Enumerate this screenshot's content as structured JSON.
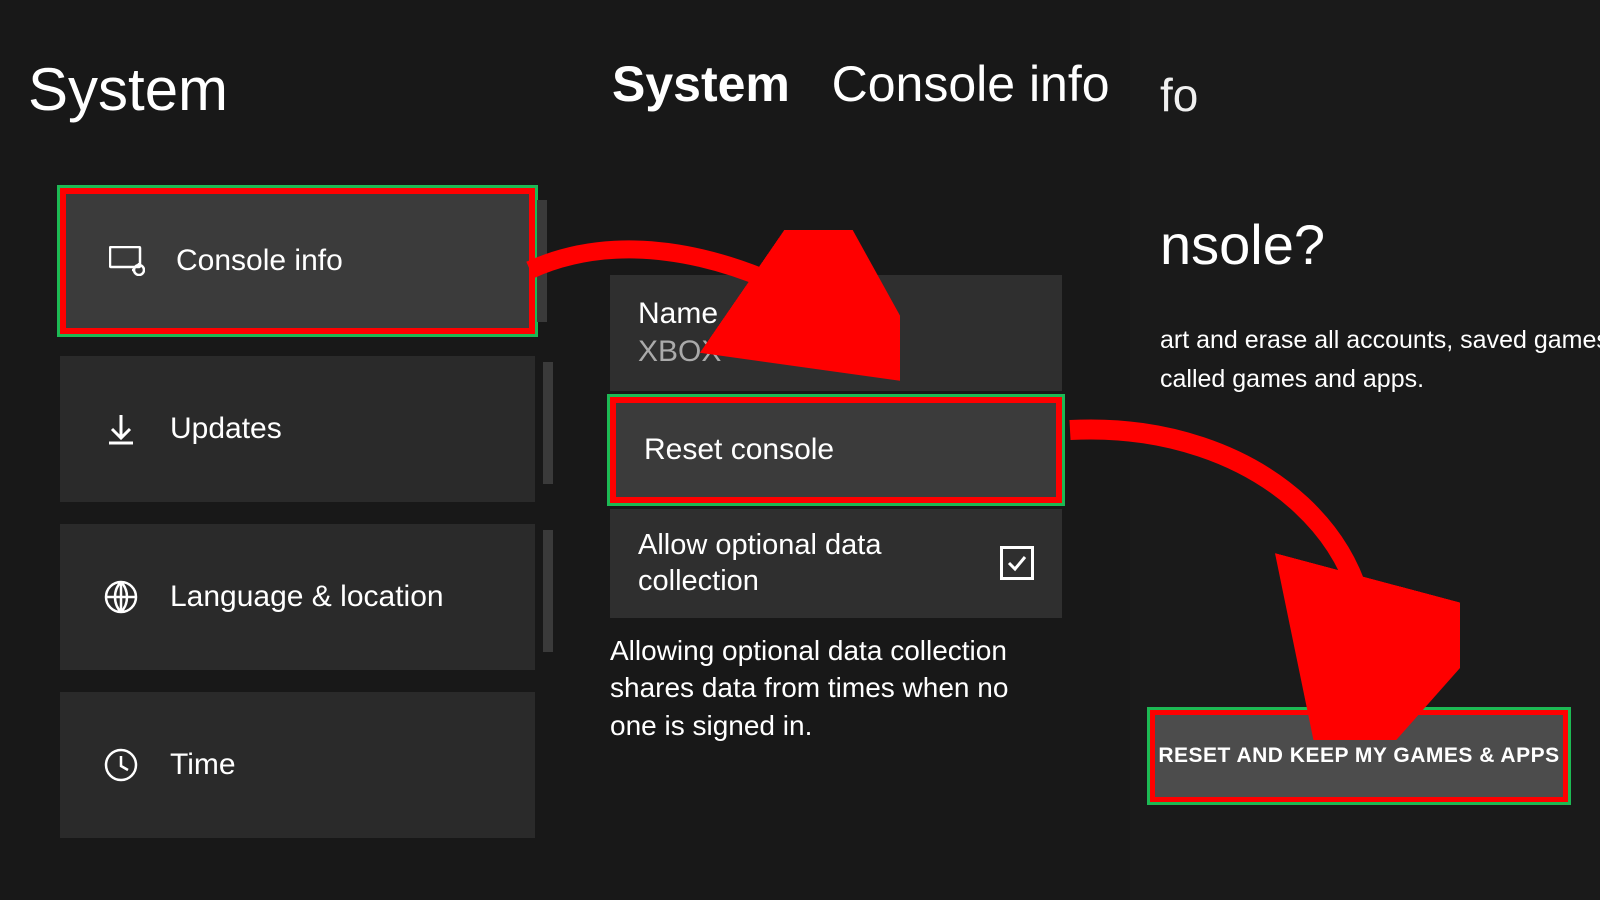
{
  "left": {
    "title": "System"
  },
  "mid": {
    "title_bold": "System",
    "title_rest": "Console info"
  },
  "sidebar": {
    "items": [
      {
        "label": "Console info"
      },
      {
        "label": "Updates"
      },
      {
        "label": "Language & location"
      },
      {
        "label": "Time"
      }
    ]
  },
  "content": {
    "name_label": "Name",
    "name_value": "XBOX",
    "reset_label": "Reset console",
    "allow_label": "Allow optional data collection",
    "allow_desc": "Allowing optional data collection shares data from times when no one is signed in."
  },
  "confirm": {
    "bg_title": "fo",
    "title": "nsole?",
    "desc_line1": "art and erase all accounts, saved games, setti",
    "desc_line2": "called games and apps.",
    "button": "RESET AND KEEP MY GAMES & APPS"
  }
}
